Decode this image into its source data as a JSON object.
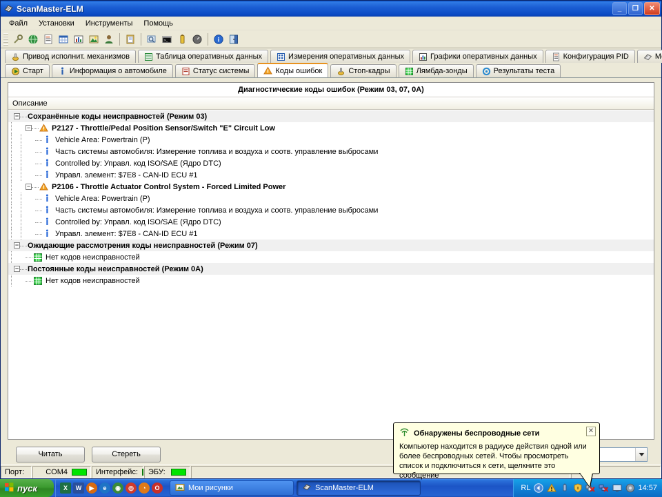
{
  "window": {
    "title": "ScanMaster-ELM",
    "icon": "scanmaster-icon",
    "minimize": "_",
    "maximize": "❐",
    "close": "✕"
  },
  "menubar": {
    "items": [
      {
        "label": "Файл"
      },
      {
        "label": "Установки"
      },
      {
        "label": "Инструменты"
      },
      {
        "label": "Помощь"
      }
    ]
  },
  "toolbar": {
    "icons": [
      {
        "name": "connect-icon",
        "glyph": "🔌",
        "color": "#9a9a6a"
      },
      {
        "name": "globe-icon",
        "glyph": "🌐",
        "color": "#1f8a3a"
      },
      {
        "name": "report-icon",
        "glyph": "📄",
        "color": "#d05a2a"
      },
      {
        "name": "table-icon",
        "glyph": "▦",
        "color": "#2a5fb0"
      },
      {
        "name": "chart-icon",
        "glyph": "📊",
        "color": "#b03a2a"
      },
      {
        "name": "image-icon",
        "glyph": "🖼",
        "color": "#2a8a3a"
      },
      {
        "name": "user-icon",
        "glyph": "👤",
        "color": "#7a5a2a"
      },
      {
        "name": "clipboard-icon",
        "glyph": "📋",
        "color": "#c8a03a"
      },
      {
        "name": "search-window-icon",
        "glyph": "🔍",
        "color": "#5a7aa0"
      },
      {
        "name": "terminal-icon",
        "glyph": "▬",
        "color": "#1a1a1a"
      },
      {
        "name": "battery-icon",
        "glyph": "🔋",
        "color": "#c8a03a"
      },
      {
        "name": "gauge-icon",
        "glyph": "⬤",
        "color": "#555555"
      },
      {
        "name": "info-icon",
        "glyph": "i",
        "color": "#1a60c0"
      },
      {
        "name": "exit-icon",
        "glyph": "🚪",
        "color": "#2a6aa8"
      }
    ]
  },
  "tabs_top": [
    {
      "label": "Привод исполнит. механизмов",
      "icon": "actuator-icon",
      "active": false
    },
    {
      "label": "Таблица оперативных данных",
      "icon": "datatable-icon",
      "active": false
    },
    {
      "label": "Измерения оперативных данных",
      "icon": "measure-icon",
      "active": false
    },
    {
      "label": "Графики оперативных данных",
      "icon": "graph-icon",
      "active": false
    },
    {
      "label": "Конфигурация PID",
      "icon": "pid-icon",
      "active": false
    },
    {
      "label": "Мощность",
      "icon": "power-icon",
      "active": false
    }
  ],
  "tabs_bottom": [
    {
      "label": "Старт",
      "icon": "start-icon",
      "active": false
    },
    {
      "label": "Информация о автомобиле",
      "icon": "info-icon",
      "active": false
    },
    {
      "label": "Статус системы",
      "icon": "status-icon",
      "active": false
    },
    {
      "label": "Коды ошибок",
      "icon": "warning-icon",
      "active": true
    },
    {
      "label": "Стоп-кадры",
      "icon": "freezeframe-icon",
      "active": false
    },
    {
      "label": "Лямбда-зонды",
      "icon": "lambda-icon",
      "active": false
    },
    {
      "label": "Результаты теста",
      "icon": "testresults-icon",
      "active": false
    }
  ],
  "panel": {
    "title": "Диагностические коды ошибок (Режим 03, 07, 0A)",
    "column_header": "Описание"
  },
  "tree": [
    {
      "type": "group",
      "label": "Сохранённые коды неисправностей (Режим 03)",
      "expander": "−",
      "children": [
        {
          "type": "dtc",
          "icon": "warning-icon",
          "expander": "−",
          "label": "P2127 - Throttle/Pedal Position Sensor/Switch \"E\" Circuit Low",
          "children": [
            {
              "type": "item",
              "icon": "info-icon",
              "label": "Vehicle Area: Powertrain (P)"
            },
            {
              "type": "item",
              "icon": "info-icon",
              "label": "Часть системы автомобиля: Измерение топлива и воздуха и соотв. управление выбросами"
            },
            {
              "type": "item",
              "icon": "info-icon",
              "label": "Controlled by: Управл. код ISO/SAE  (Ядро DTC)"
            },
            {
              "type": "item",
              "icon": "info-icon",
              "label": "Управл. элемент: $7E8 - CAN-ID ECU #1"
            }
          ]
        },
        {
          "type": "dtc",
          "icon": "warning-icon",
          "expander": "−",
          "label": "P2106 - Throttle Actuator Control System - Forced Limited Power",
          "children": [
            {
              "type": "item",
              "icon": "info-icon",
              "label": "Vehicle Area: Powertrain (P)"
            },
            {
              "type": "item",
              "icon": "info-icon",
              "label": "Часть системы автомобиля: Измерение топлива и воздуха и соотв. управление выбросами"
            },
            {
              "type": "item",
              "icon": "info-icon",
              "label": "Controlled by: Управл. код ISO/SAE  (Ядро DTC)"
            },
            {
              "type": "item",
              "icon": "info-icon",
              "label": "Управл. элемент: $7E8 - CAN-ID ECU #1"
            }
          ]
        }
      ]
    },
    {
      "type": "group",
      "label": "Ожидающие рассмотрения коды неисправностей (Режим 07)",
      "expander": "−",
      "children": [
        {
          "type": "ok",
          "icon": "ok-grid-icon",
          "label": "Нет кодов неисправностей"
        }
      ]
    },
    {
      "type": "group",
      "label": "Постоянные коды неисправностей  (Режим 0A)",
      "expander": "−",
      "children": [
        {
          "type": "ok",
          "icon": "ok-grid-icon",
          "label": "Нет кодов неисправностей"
        }
      ]
    }
  ],
  "bottom": {
    "read_button": "Читать",
    "erase_button": "Стереть",
    "combo_value": "",
    "combo_arrow": "⌄"
  },
  "statusbar": {
    "port_label": "Порт:",
    "port_value": "COM4",
    "interface_label": "Интерфейс:",
    "ecu_label": "ЭБУ:",
    "led_color": "#00e400"
  },
  "balloon": {
    "icon": "wireless-icon",
    "title": "Обнаружены беспроводные сети",
    "body": "Компьютер находится в радиусе действия одной или более беспроводных сетей. Чтобы просмотреть список и подключиться к сети, щелкните это сообщение",
    "close": "✕"
  },
  "taskbar": {
    "start_label": "пуск",
    "quicklaunch": [
      {
        "name": "excel-icon",
        "glyph": "X",
        "color": "#1d7044"
      },
      {
        "name": "word-icon",
        "glyph": "W",
        "color": "#2a4f9b"
      },
      {
        "name": "media-player-icon",
        "glyph": "▶",
        "color": "#d86a10"
      },
      {
        "name": "internet-explorer-icon",
        "glyph": "e",
        "color": "#1e74c6"
      },
      {
        "name": "browser-icon",
        "glyph": "◉",
        "color": "#3a8a3a"
      },
      {
        "name": "chrome-icon",
        "glyph": "◎",
        "color": "#d03a2a"
      },
      {
        "name": "firefox-icon",
        "glyph": "◔",
        "color": "#e07a18"
      },
      {
        "name": "opera-icon",
        "glyph": "O",
        "color": "#c8302a"
      }
    ],
    "buttons": [
      {
        "label": "Мои рисунки",
        "icon": "folder-icon",
        "active": false
      },
      {
        "label": "ScanMaster-ELM",
        "icon": "scanmaster-icon",
        "active": true
      }
    ],
    "tray": {
      "language": "RL",
      "icons": [
        {
          "name": "chevron-left-icon",
          "glyph": "‹"
        },
        {
          "name": "warning-tray-icon",
          "glyph": "⚠"
        },
        {
          "name": "usb-device-icon",
          "glyph": "🔌"
        },
        {
          "name": "security-shield-icon",
          "glyph": "🛡"
        },
        {
          "name": "network-disconnected-icon",
          "glyph": "⇄"
        },
        {
          "name": "network-error-icon",
          "glyph": "🖧"
        },
        {
          "name": "display-icon",
          "glyph": "🖵"
        },
        {
          "name": "sound-icon",
          "glyph": "◍"
        }
      ],
      "clock": "14:57"
    }
  }
}
